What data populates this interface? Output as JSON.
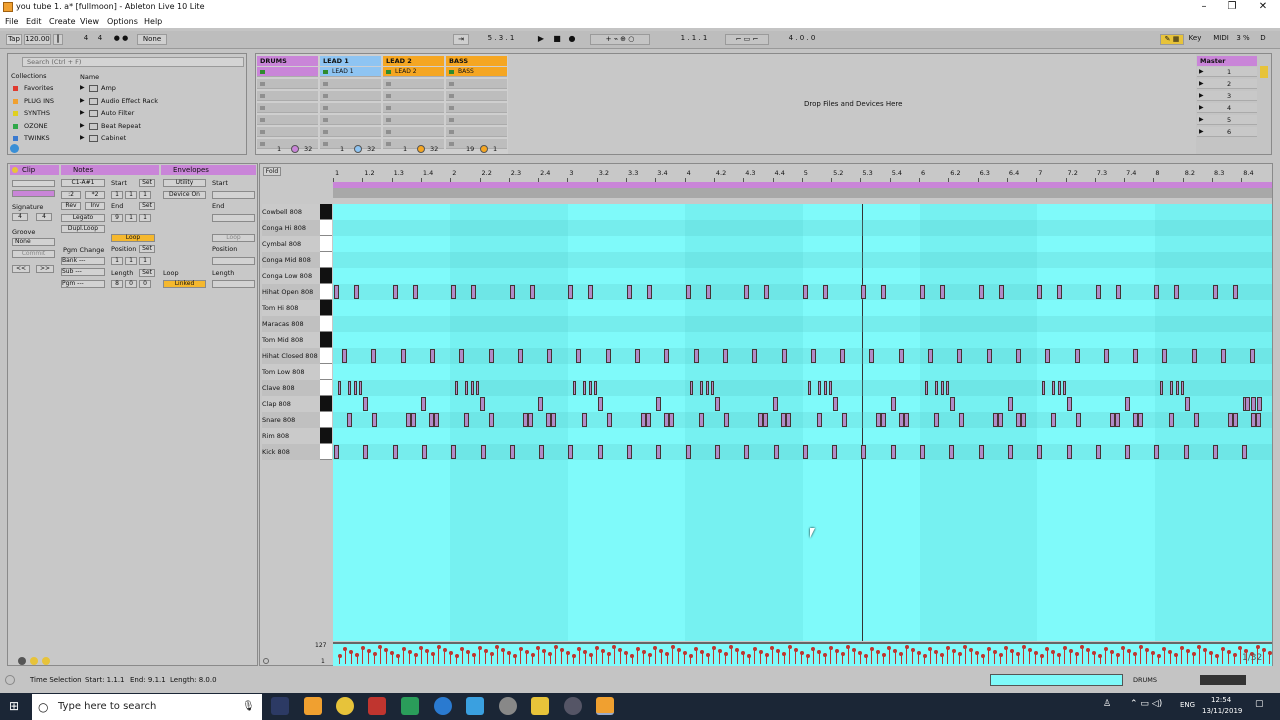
{
  "window": {
    "title": "you tube 1. a* [fullmoon] - Ableton Live 10 Lite",
    "minimize": "–",
    "maximize": "❐",
    "close": "✕"
  },
  "menu": [
    "File",
    "Edit",
    "Create",
    "View",
    "Options",
    "Help"
  ],
  "control_bar": {
    "tap": "Tap",
    "tempo": "120.00",
    "meter_num": "4",
    "meter_den": "4",
    "metro": "● ●",
    "quantize": "None",
    "position": "5 .  3 .  1",
    "loop_start": "1 .  1 .  1",
    "loop_length": "4 .  0 .  0",
    "key": "Key",
    "midi": "MIDI",
    "cpu": "3 %",
    "disk": "D"
  },
  "browser": {
    "search_placeholder": "Search (Ctrl + F)",
    "collections_label": "Collections",
    "name_label": "Name",
    "collections": [
      {
        "label": "Favorites",
        "color": "#e03a2f"
      },
      {
        "label": "PLUG INS",
        "color": "#f0a030"
      },
      {
        "label": "SYNTHS",
        "color": "#e0d020"
      },
      {
        "label": "OZONE",
        "color": "#2fa84a"
      },
      {
        "label": "TWINKS",
        "color": "#3a7ad0"
      }
    ],
    "items": [
      "Amp",
      "Audio Effect Rack",
      "Auto Filter",
      "Beat Repeat",
      "Cabinet"
    ]
  },
  "session": {
    "tracks": [
      {
        "name": "DRUMS",
        "color": "#c985d8",
        "clip": "",
        "num": "1",
        "vol": "32"
      },
      {
        "name": "LEAD 1",
        "color": "#8ec4f2",
        "clip": "LEAD 1",
        "num": "1",
        "vol": "32"
      },
      {
        "name": "LEAD 2",
        "color": "#f5a622",
        "clip": "LEAD 2",
        "num": "1",
        "vol": "32"
      },
      {
        "name": "BASS",
        "color": "#f5a622",
        "clip": "BASS",
        "num": "19",
        "vol": "1"
      }
    ],
    "drop_text": "Drop Files and Devices Here",
    "master": {
      "name": "Master",
      "scenes": [
        "1",
        "2",
        "3",
        "4",
        "5",
        "6"
      ]
    }
  },
  "clip_panel": {
    "clip_title": "Clip",
    "notes_title": "Notes",
    "envelopes_title": "Envelopes",
    "signature_label": "Signature",
    "sig_num": "4",
    "sig_den": "4",
    "groove_label": "Groove",
    "groove_value": "None",
    "commit": "Commit",
    "note_range": "C1-A#1",
    "half": ":2",
    "double": "*2",
    "rev": "Rev",
    "inv": "Inv",
    "legato": "Legato",
    "dupl": "Dupl.Loop",
    "start_label": "Start",
    "set": "Set",
    "end_label": "End",
    "start_vals": [
      "1",
      "1",
      "1"
    ],
    "end_vals": [
      "9",
      "1",
      "1"
    ],
    "loop": "Loop",
    "position_label": "Position",
    "pos_vals": [
      "1",
      "1",
      "1"
    ],
    "length_label": "Length",
    "len_vals": [
      "8",
      "0",
      "0"
    ],
    "pgm_change": "Pgm Change",
    "bank": "Bank ---",
    "sub": "Sub ---",
    "pgm": "Pgm ---",
    "env_device": "Utility",
    "env_param": "Device On",
    "env_start": "Start",
    "env_end": "End",
    "env_loop": "Loop",
    "env_position": "Position",
    "env_length": "Length",
    "env_loop_label": "Loop",
    "linked": "Linked"
  },
  "editor": {
    "fold": "Fold",
    "ruler": [
      "1",
      "1.2",
      "1.3",
      "1.4",
      "2",
      "2.2",
      "2.3",
      "2.4",
      "3",
      "3.2",
      "3.3",
      "3.4",
      "4",
      "4.2",
      "4.3",
      "4.4",
      "5",
      "5.2",
      "5.3",
      "5.4",
      "6",
      "6.2",
      "6.3",
      "6.4",
      "7",
      "7.2",
      "7.3",
      "7.4",
      "8",
      "8.2",
      "8.3",
      "8.4"
    ],
    "lanes": [
      "Cowbell 808",
      "Conga Hi 808",
      "Cymbal 808",
      "Conga Mid 808",
      "Conga Low 808",
      "Hihat Open 808",
      "Tom Hi 808",
      "Maracas 808",
      "Tom Mid 808",
      "Hihat Closed 808",
      "Tom Low 808",
      "Clave 808",
      "Clap 808",
      "Snare 808",
      "Rim 808",
      "Kick 808"
    ],
    "vel_max": "127",
    "vel_min": "1",
    "zoom": "1/32"
  },
  "status": {
    "label": "Time Selection",
    "start": "Start: 1.1.1",
    "end": "End: 9.1.1",
    "length": "Length: 8.0.0",
    "track": "DRUMS"
  },
  "taskbar": {
    "search": "Type here to search",
    "time": "12:54",
    "date": "13/11/2019",
    "lang": "ENG"
  }
}
